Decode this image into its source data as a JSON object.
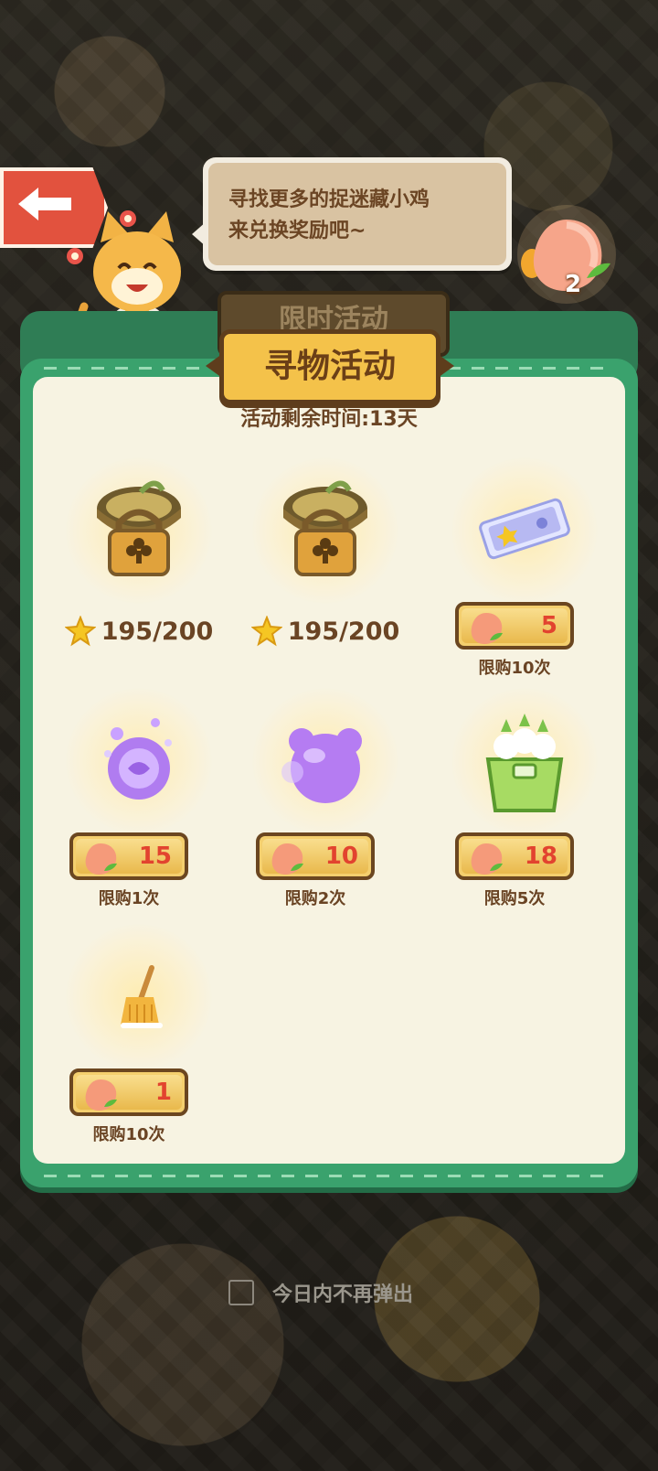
{
  "speech_bubble": {
    "text": "寻找更多的捉迷藏小鸡\n来兑换奖励吧~"
  },
  "currency": {
    "icon": "peach-icon",
    "count": "2"
  },
  "tabs": {
    "back_tab": "限时活动",
    "active_tab": "寻物活动"
  },
  "timer": "活动剩余时间:13天",
  "items": [
    {
      "icon": "lock-pot-icon",
      "type": "progress",
      "progress": "195/200"
    },
    {
      "icon": "lock-pot-icon",
      "type": "progress",
      "progress": "195/200"
    },
    {
      "icon": "ticket-icon",
      "type": "price",
      "price": "5",
      "limit": "限购10次"
    },
    {
      "icon": "purple-orb-icon",
      "type": "price",
      "price": "15",
      "limit": "限购1次"
    },
    {
      "icon": "purple-bear-bubble-icon",
      "type": "price",
      "price": "10",
      "limit": "限购2次"
    },
    {
      "icon": "green-bag-icon",
      "type": "price",
      "price": "18",
      "limit": "限购5次"
    },
    {
      "icon": "broom-icon",
      "type": "price",
      "price": "1",
      "limit": "限购10次"
    }
  ],
  "dont_show_today": {
    "label": "今日内不再弹出",
    "checked": false
  },
  "colors": {
    "panel_green": "#3aa26d",
    "panel_cream": "#f7f3e2",
    "price_red": "#e2432f",
    "tab_gold": "#f4c24a"
  }
}
